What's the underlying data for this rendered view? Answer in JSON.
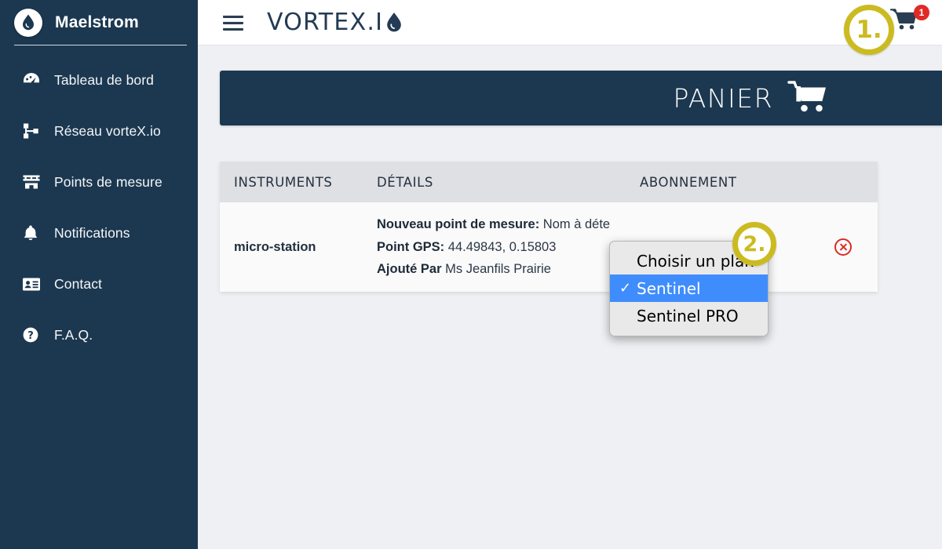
{
  "sidebar": {
    "brand": {
      "title": "Maelstrom",
      "logo_icon": "water-droplet-icon"
    },
    "items": [
      {
        "label": "Tableau de bord",
        "icon": "dashboard-gauge-icon"
      },
      {
        "label": "Réseau vorteX.io",
        "icon": "network-sitemap-icon"
      },
      {
        "label": "Points de mesure",
        "icon": "measurement-station-icon"
      },
      {
        "label": "Notifications",
        "icon": "bell-icon"
      },
      {
        "label": "Contact",
        "icon": "contact-card-icon"
      },
      {
        "label": "F.A.Q.",
        "icon": "question-mark-circle-icon"
      }
    ]
  },
  "topbar": {
    "menu_icon": "hamburger-menu-icon",
    "logo": {
      "part1": "VORTE",
      "part_x": "X",
      "part2": ".I",
      "drop_icon": "water-droplet-icon"
    },
    "cart": {
      "icon": "shopping-cart-icon",
      "badge_count": "1"
    }
  },
  "annotations": [
    {
      "id": "annot-1",
      "label": "1."
    },
    {
      "id": "annot-2",
      "label": "2."
    }
  ],
  "main": {
    "banner": {
      "title": "PANIER",
      "icon": "shopping-cart-icon"
    },
    "table": {
      "columns": [
        "INSTRUMENTS",
        "DÉTAILS",
        "ABONNEMENT"
      ],
      "rows": [
        {
          "instrument": "micro-station",
          "details": [
            {
              "label": "Nouveau point de mesure:",
              "value": "Nom à déte"
            },
            {
              "label": "Point GPS:",
              "value": "44.49843, 0.15803"
            },
            {
              "label": "Ajouté Par",
              "value": "Ms Jeanfils Prairie"
            }
          ],
          "remove_icon": "remove-circle-x-icon"
        }
      ]
    },
    "plan_dropdown": {
      "options": [
        {
          "label": "Choisir un plan",
          "selected": false
        },
        {
          "label": "Sentinel",
          "selected": true,
          "check": "✓"
        },
        {
          "label": "Sentinel PRO",
          "selected": false
        }
      ]
    }
  },
  "colors": {
    "sidebar_bg": "#1c3850",
    "banner_bg": "#1c3850",
    "accent_gold": "#cbbb20",
    "badge_red": "#e02a26",
    "select_blue": "#3f8dfd",
    "page_bg": "#eff0f3"
  }
}
